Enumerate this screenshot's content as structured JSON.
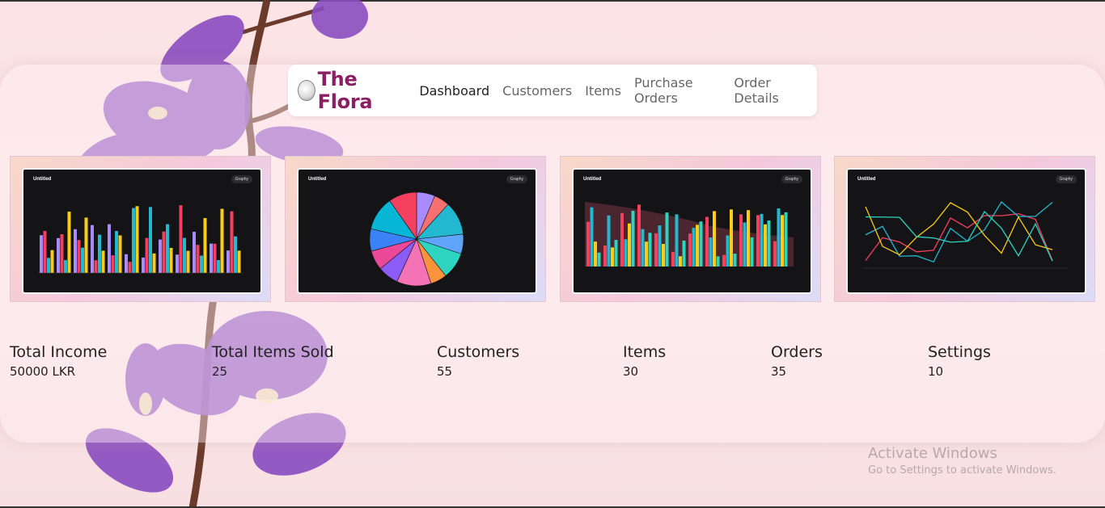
{
  "brand": {
    "name": "The Flora",
    "logo_icon": "flora-logo-icon"
  },
  "nav": {
    "items": [
      {
        "label": "Dashboard",
        "active": true
      },
      {
        "label": "Customers",
        "active": false
      },
      {
        "label": "Items",
        "active": false
      },
      {
        "label": "Purchase Orders",
        "active": false
      },
      {
        "label": "Order Details",
        "active": false
      }
    ]
  },
  "cards": [
    {
      "title": "Untitled",
      "badge": "Graphy",
      "kind": "grouped-bar"
    },
    {
      "title": "Untitled",
      "badge": "Graphy",
      "kind": "pie"
    },
    {
      "title": "Untitled",
      "badge": "Graphy",
      "kind": "bar-area"
    },
    {
      "title": "Untitled",
      "badge": "Graphy",
      "kind": "line"
    }
  ],
  "stats": [
    {
      "label": "Total Income",
      "value": "50000 LKR"
    },
    {
      "label": "Total Items Sold",
      "value": "25"
    },
    {
      "label": "Customers",
      "value": "55"
    },
    {
      "label": "Items",
      "value": "30"
    },
    {
      "label": "Orders",
      "value": "35"
    },
    {
      "label": "Settings",
      "value": "10"
    }
  ],
  "watermark": {
    "line1": "Activate Windows",
    "line2": "Go to Settings to activate Windows."
  },
  "colors": {
    "brand": "#8b1f63",
    "series": [
      "#a78bfa",
      "#f472b6",
      "#22b8cf",
      "#facc15",
      "#2dd4bf",
      "#f43f5e"
    ]
  }
}
